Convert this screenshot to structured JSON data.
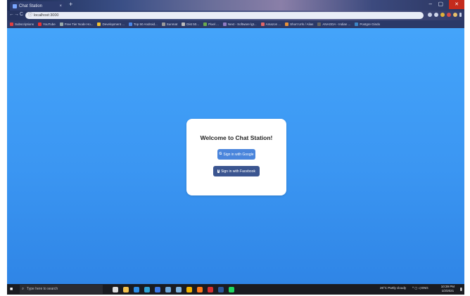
{
  "browser": {
    "tab_title": "Chat Station",
    "tab_close": "×",
    "new_tab": "+",
    "url": "localhost:3000",
    "window_controls": {
      "minimize": "–",
      "maximize": "▢",
      "close": "✕"
    },
    "nav": {
      "back": "←",
      "forward": "→",
      "reload": "C"
    },
    "bookmarks": [
      {
        "label": "Subscriptions",
        "color": "#e04040"
      },
      {
        "label": "YouTube",
        "color": "#e33"
      },
      {
        "label": "Free Tier Node Ho...",
        "color": "#9aa"
      },
      {
        "label": "Development ...",
        "color": "#f1c232"
      },
      {
        "label": "Top 50 Android...",
        "color": "#4a86e8"
      },
      {
        "label": "Sunmat",
        "color": "#999"
      },
      {
        "label": "Dist 50...",
        "color": "#bbb"
      },
      {
        "label": "Pixel ...",
        "color": "#6aa84f"
      },
      {
        "label": "Next - Software lgt...",
        "color": "#8e7cc3"
      },
      {
        "label": "Amazon ...",
        "color": "#e06666"
      },
      {
        "label": "Short Urls / Alias",
        "color": "#e69138"
      },
      {
        "label": "ANAGDA - Indian ...",
        "color": "#666"
      },
      {
        "label": "Postgre Gindo",
        "color": "#3d85c6"
      }
    ]
  },
  "page": {
    "heading": "Welcome to Chat Station!",
    "google_button": "Sign in with Google",
    "google_icon": "G",
    "facebook_button": "Sign in with Facebook",
    "facebook_icon": "f"
  },
  "taskbar": {
    "start_icon": "■",
    "search_placeholder": "Type here to search",
    "search_icon": "⌕",
    "weather": "26°C Partly cloudy",
    "tray_icons": "^ ◻ ◁ ENG",
    "time": "10:39 PM",
    "date": "1/2/2021",
    "notification_icon": "▮",
    "apps": [
      {
        "name": "task-view-icon",
        "color": "#dcdcdc"
      },
      {
        "name": "file-explorer-icon",
        "color": "#f2c14e"
      },
      {
        "name": "vscode-icon",
        "color": "#2d8ee8"
      },
      {
        "name": "edge-icon",
        "color": "#2fa3d6"
      },
      {
        "name": "store-icon",
        "color": "#3b78e7"
      },
      {
        "name": "calendar-icon",
        "color": "#6fa8dc"
      },
      {
        "name": "photos-icon",
        "color": "#7fb3e0"
      },
      {
        "name": "chrome-icon",
        "color": "#f4b400"
      },
      {
        "name": "firefox-icon",
        "color": "#ff7a1a"
      },
      {
        "name": "media-icon",
        "color": "#d62f2f"
      },
      {
        "name": "word-icon",
        "color": "#2b579a"
      },
      {
        "name": "spotify-icon",
        "color": "#1ed760"
      }
    ]
  }
}
